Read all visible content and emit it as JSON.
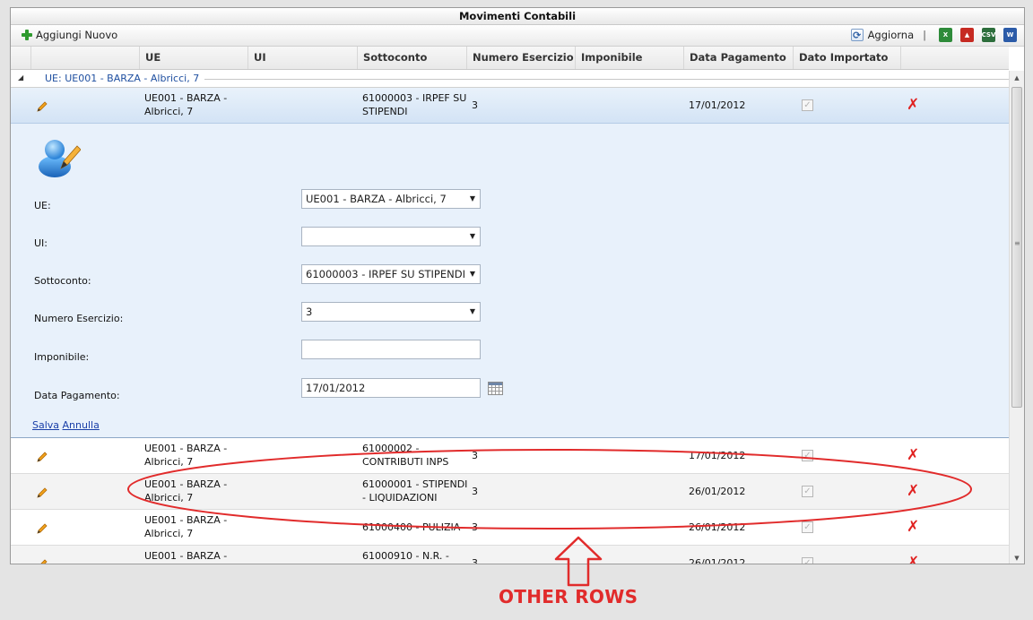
{
  "title": "Movimenti Contabili",
  "toolbar": {
    "add_label": "Aggiungi Nuovo",
    "refresh_label": "Aggiorna",
    "separator": "|",
    "export_icons": [
      "excel-icon",
      "pdf-icon",
      "csv-icon",
      "word-icon"
    ],
    "csv_text": "CSV"
  },
  "columns": [
    "UE",
    "UI",
    "Sottoconto",
    "Numero Esercizio",
    "Imponibile",
    "Data Pagamento",
    "Dato Importato"
  ],
  "group": {
    "toggle": "◢",
    "label": "UE: UE001 - BARZA - Albricci, 7"
  },
  "selected_row": {
    "ue": [
      "UE001 - BARZA -",
      "Albricci, 7"
    ],
    "ui": "",
    "sottoconto": [
      "61000003 - IRPEF SU",
      "STIPENDI"
    ],
    "numero_esercizio": "3",
    "imponibile": "",
    "data_pagamento": "17/01/2012",
    "dato_importato": true
  },
  "form": {
    "labels": {
      "ue": "UE:",
      "ui": "UI:",
      "sottoconto": "Sottoconto:",
      "numero_esercizio": "Numero Esercizio:",
      "imponibile": "Imponibile:",
      "data_pagamento": "Data Pagamento:"
    },
    "values": {
      "ue": "UE001  - BARZA - Albricci, 7",
      "ui": "",
      "sottoconto": "61000003 - IRPEF SU STIPENDI",
      "numero_esercizio": "3",
      "imponibile": "",
      "data_pagamento": "17/01/2012"
    },
    "save_label": "Salva",
    "cancel_label": "Annulla"
  },
  "rows": [
    {
      "ue": [
        "UE001 - BARZA -",
        "Albricci, 7"
      ],
      "sottoconto": [
        "61000002 -",
        "CONTRIBUTI INPS"
      ],
      "numero_esercizio": "3",
      "data_pagamento": "17/01/2012"
    },
    {
      "ue": [
        "UE001 - BARZA -",
        "Albricci, 7"
      ],
      "sottoconto": [
        "61000001 - STIPENDI",
        "- LIQUIDAZIONI"
      ],
      "numero_esercizio": "3",
      "data_pagamento": "26/01/2012"
    },
    {
      "ue": [
        "UE001 - BARZA -",
        "Albricci, 7"
      ],
      "sottoconto": [
        "61000400 - PULIZIA",
        ""
      ],
      "numero_esercizio": "3",
      "data_pagamento": "26/01/2012"
    },
    {
      "ue": [
        "UE001 - BARZA -",
        ""
      ],
      "sottoconto": [
        "61000910 - N.R. -",
        ""
      ],
      "numero_esercizio": "3",
      "data_pagamento": "26/01/2012"
    }
  ],
  "icons": {
    "edit": "pencil-icon",
    "delete": "delete-icon",
    "check": "✓",
    "delete_glyph": "✗"
  },
  "annotation": {
    "text": "OTHER ROWS",
    "color": "#e12b2b"
  }
}
